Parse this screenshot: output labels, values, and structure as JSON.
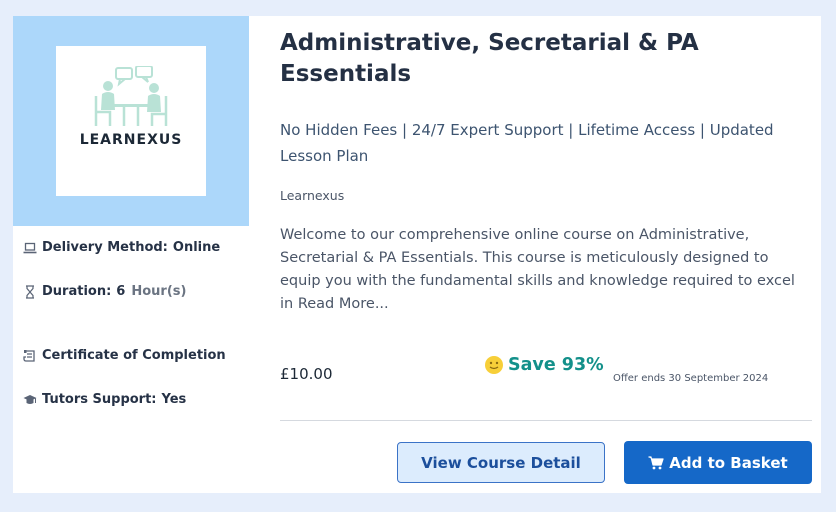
{
  "course": {
    "title": "Administrative, Secretarial & PA Essentials",
    "features": "No Hidden Fees | 24/7 Expert Support | Lifetime Access | Updated Lesson Plan",
    "provider": "Learnexus",
    "description": "Welcome to our comprehensive online course on Administrative, Secretarial & PA Essentials. This course is meticulously designed to equip you with the fundamental skills and knowledge required to excel in",
    "read_more": "Read More..."
  },
  "logo": {
    "text": "LEARNEXUS"
  },
  "meta": {
    "delivery_label": "Delivery Method:",
    "delivery_value": "Online",
    "duration_label": "Duration:",
    "duration_value": "6",
    "duration_unit": "Hour(s)",
    "certificate": "Certificate of Completion",
    "tutors_label": "Tutors Support:",
    "tutors_value": "Yes"
  },
  "pricing": {
    "price": "£10.00",
    "save": "Save 93%",
    "offer": "Offer ends 30 September 2024"
  },
  "buttons": {
    "view": "View Course Detail",
    "add": "Add to Basket"
  },
  "icons": [
    "laptop-icon",
    "hourglass-icon",
    "certificate-icon",
    "graduation-cap-icon",
    "smiley-icon",
    "cart-icon"
  ],
  "colors": {
    "thumb_bg": "#acd7fa",
    "save_green": "#13908a",
    "primary_blue": "#1568c8",
    "page_bg": "#e6eefb"
  }
}
